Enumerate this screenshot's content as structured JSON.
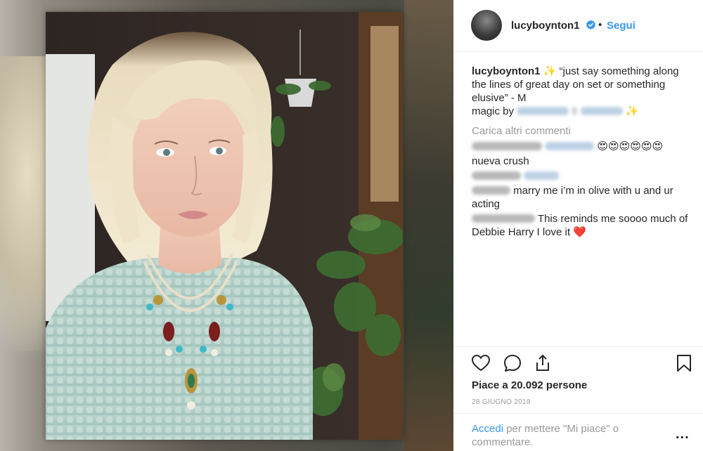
{
  "post": {
    "username": "lucyboynton1",
    "follow_label": "Segui",
    "separator": "•"
  },
  "caption": {
    "username": "lucyboynton1",
    "sparkle": "✨",
    "text": " “just say something along the lines of great day on set or something elusive” - M",
    "credit_prefix": "magic by",
    "credit_sparkle": "✨"
  },
  "load_more": "Carica altri commenti",
  "comments": [
    {
      "text": "",
      "emoji": "😍😍😍😍😍😍"
    },
    {
      "text": "nueva crush",
      "emoji": ""
    },
    {
      "text": "",
      "emoji": ""
    },
    {
      "text": "marry me i’m in olive with u and ur acting",
      "emoji": ""
    },
    {
      "text": "This reminds me soooo much of Debbie Harry I love it",
      "emoji": "❤️"
    }
  ],
  "likes": "Piace a 20.092 persone",
  "date": "28 GIUGNO 2018",
  "footer": {
    "login_link": "Accedi",
    "login_text": " per mettere \"Mi piace\" o commentare.",
    "more": "..."
  },
  "icons": {
    "heart": "heart-icon",
    "comment": "comment-icon",
    "share": "share-icon",
    "bookmark": "bookmark-icon",
    "verified": "verified-badge-icon"
  },
  "colors": {
    "link": "#3897f0",
    "muted": "#999999",
    "text": "#262626"
  }
}
